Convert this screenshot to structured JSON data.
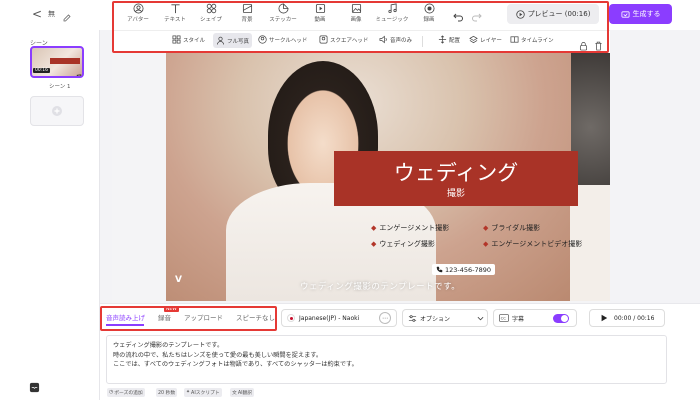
{
  "header": {
    "back_label": "<",
    "project_name": "無",
    "preview_label": "プレビュー (00:16)",
    "generate_label": "生成する"
  },
  "tools": [
    {
      "label": "アバター",
      "icon": "avatar-icon"
    },
    {
      "label": "テキスト",
      "icon": "text-icon"
    },
    {
      "label": "シェイプ",
      "icon": "shape-icon"
    },
    {
      "label": "背景",
      "icon": "background-icon"
    },
    {
      "label": "ステッカー",
      "icon": "sticker-icon"
    },
    {
      "label": "動画",
      "icon": "video-icon"
    },
    {
      "label": "画像",
      "icon": "image-icon"
    },
    {
      "label": "ミュージック",
      "icon": "music-icon"
    },
    {
      "label": "録画",
      "icon": "record-icon"
    }
  ],
  "subtools": [
    {
      "label": "スタイル",
      "icon": "style-icon"
    },
    {
      "label": "フル写真",
      "icon": "fullphoto-icon"
    },
    {
      "label": "サークルヘッド",
      "icon": "circlehead-icon"
    },
    {
      "label": "スクエアヘッド",
      "icon": "squarehead-icon"
    },
    {
      "label": "音声のみ",
      "icon": "voiceonly-icon"
    },
    {
      "label": "配置",
      "icon": "arrange-icon"
    },
    {
      "label": "レイヤー",
      "icon": "layer-icon"
    },
    {
      "label": "タイムライン",
      "icon": "timeline-icon"
    }
  ],
  "scenes": {
    "title": "シーン",
    "scene_label": "シーン 1",
    "thumb_time": "00:16"
  },
  "canvas": {
    "title": "ウェディング",
    "subtitle": "撮影",
    "bullets": [
      "エンゲージメント撮影",
      "ブライダル撮影",
      "ウェディング撮影",
      "エンゲージメントビデオ撮影"
    ],
    "phone": "123-456-7890",
    "caption": "ウェディング撮影のテンプレートです。"
  },
  "bottom": {
    "tabs": [
      "音声読み上げ",
      "録音",
      "アップロード",
      "スピーチなし"
    ],
    "new_badge": "NEW",
    "voice_name": "Japanese(JP) - Naoki",
    "options_label": "オプション",
    "subtitle_label": "字幕",
    "time_display": "00:00 / 00:16",
    "script_lines": [
      "ウェディング撮影のテンプレートです。",
      "時の流れの中で、私たちはレンズを使って愛の最も美しい瞬間を捉えます。",
      "ここでは、すべてのウェディングフォトは物語であり、すべてのシャッターは約束です。"
    ],
    "footer": [
      "ポーズの追加",
      "20 秒数",
      "AIスクリプト",
      "AI翻訳"
    ]
  },
  "colors": {
    "accent": "#8b3dff",
    "brand_red": "#a93327",
    "highlight_red": "#e53935"
  }
}
